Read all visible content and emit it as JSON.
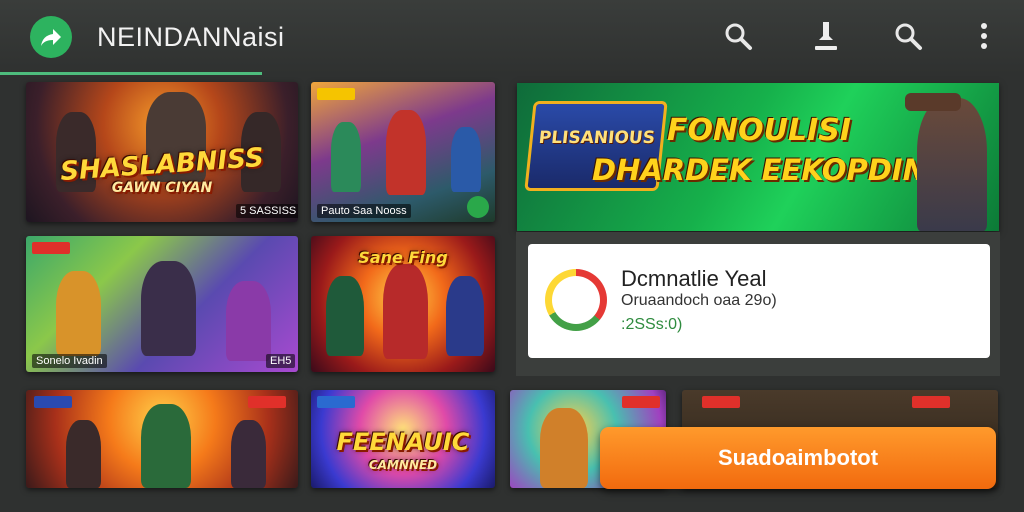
{
  "header": {
    "title": "NEINDANNaisi",
    "icons": [
      "share-arrow-icon",
      "magnifier-icon",
      "pin-icon",
      "search-icon",
      "more-vert-icon"
    ]
  },
  "grid": [
    {
      "logo": "SHASLABNISS",
      "logo_sub": "GAWN CIYAN",
      "caption": "5 SASSISS"
    },
    {
      "caption": "Pauto Saa Nooss"
    },
    {
      "caption": "Sonelo Ivadin",
      "caption_right": "EH5"
    },
    {
      "logo": "Sane Fing"
    },
    {
      "logo": "FEENAUIC",
      "logo_sub": "CAMNNED"
    }
  ],
  "featured": {
    "line1": "FONOULISI",
    "line2": "DHARDEK EEKOPDING!",
    "logo": "PLISANIOUS"
  },
  "panel": {
    "title": "Dcmnatlie Yeal",
    "subtitle": "Oruaandoch oaa 29o)",
    "price": ":2SSs:0)"
  },
  "cta_label": "Suadoaimbotot",
  "colors": {
    "accent_green": "#2db35f",
    "cta_orange": "#f57c1a"
  }
}
